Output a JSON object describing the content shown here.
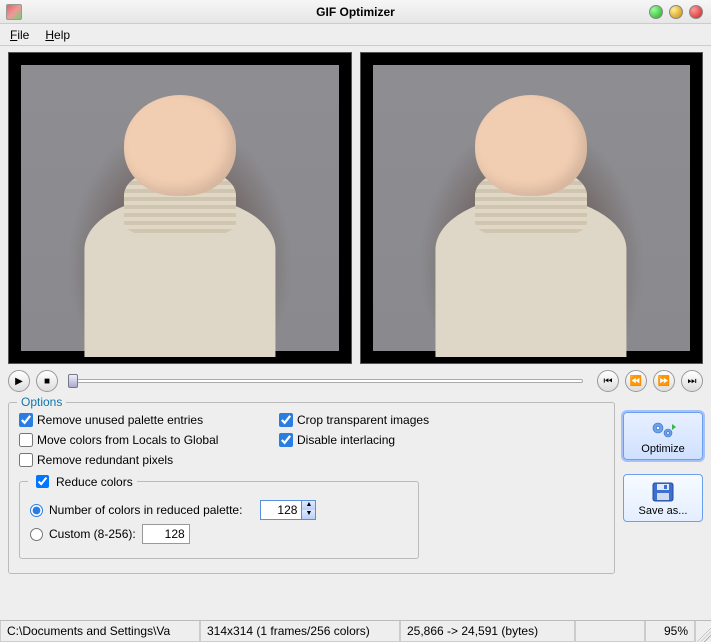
{
  "window": {
    "title": "GIF Optimizer"
  },
  "menu": {
    "file": "File",
    "help": "Help"
  },
  "transport": {
    "play_icon": "▶",
    "stop_icon": "■",
    "first_icon": "⏮",
    "prev_icon": "⏪",
    "next_icon": "⏩",
    "last_icon": "⏭"
  },
  "options": {
    "legend": "Options",
    "remove_unused": {
      "label": "Remove unused palette entries",
      "checked": true
    },
    "move_colors": {
      "label": "Move colors from Locals to Global",
      "checked": false
    },
    "remove_redund": {
      "label": "Remove redundant pixels",
      "checked": false
    },
    "crop_trans": {
      "label": "Crop transparent images",
      "checked": true
    },
    "disable_inter": {
      "label": "Disable interlacing",
      "checked": true
    },
    "reduce": {
      "legend": "Reduce colors",
      "checked": true,
      "num_label": "Number of colors in reduced palette:",
      "num_value": "128",
      "custom_label": "Custom (8-256):",
      "custom_value": "128",
      "selected": "num"
    }
  },
  "buttons": {
    "optimize": "Optimize",
    "saveas": "Save as..."
  },
  "status": {
    "path": "C:\\Documents and Settings\\Va",
    "dims": "314x314 (1 frames/256 colors)",
    "bytes": "25,866 -> 24,591 (bytes)",
    "pct": "95%"
  }
}
